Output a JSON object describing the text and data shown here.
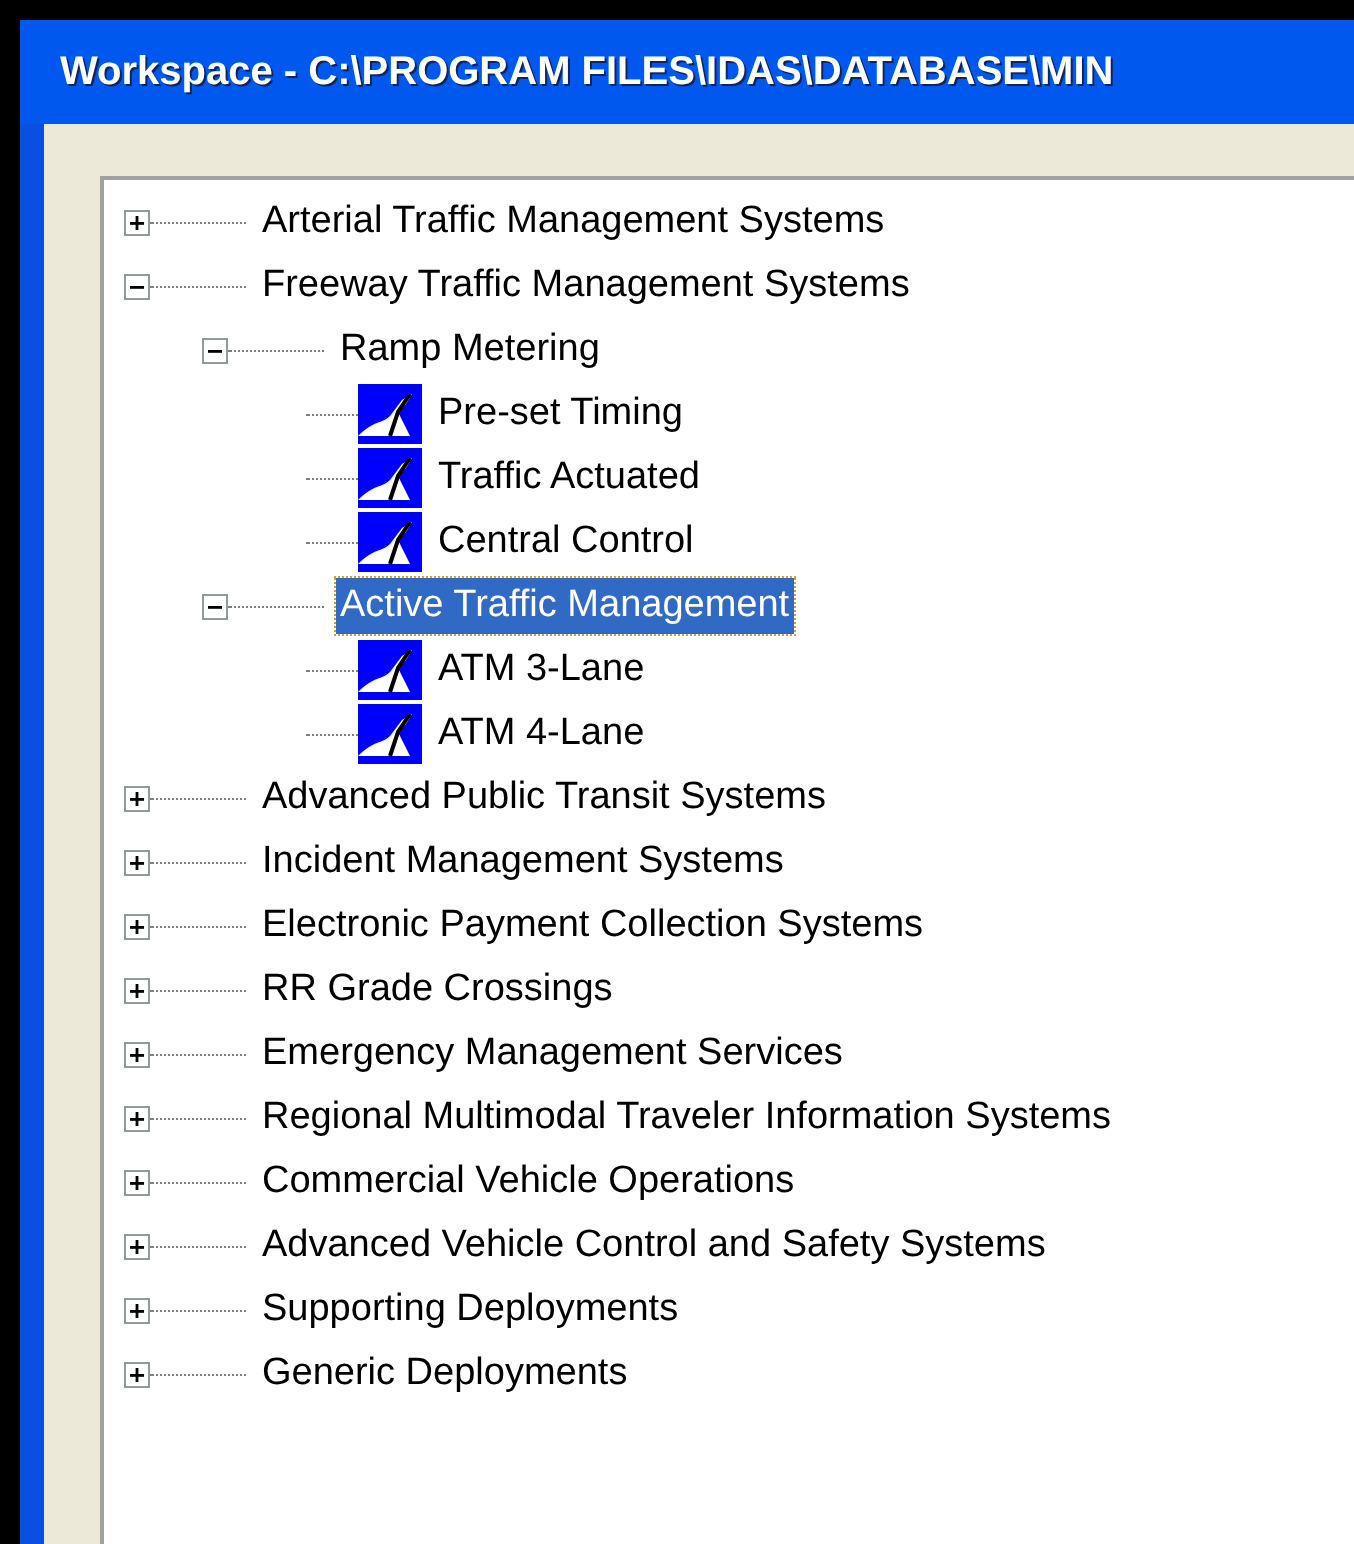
{
  "window": {
    "title": "Workspace - C:\\PROGRAM FILES\\IDAS\\DATABASE\\MIN"
  },
  "tree": {
    "items": [
      {
        "label": "Arterial Traffic Management Systems",
        "expanded": false,
        "selected": false
      },
      {
        "label": "Freeway Traffic Management Systems",
        "expanded": true,
        "selected": false,
        "children": [
          {
            "label": "Ramp Metering",
            "expanded": true,
            "selected": false,
            "children": [
              {
                "label": "Pre-set Timing",
                "kind": "leaf",
                "selected": false
              },
              {
                "label": "Traffic Actuated",
                "kind": "leaf",
                "selected": false
              },
              {
                "label": "Central Control",
                "kind": "leaf",
                "selected": false
              }
            ]
          },
          {
            "label": "Active Traffic Management",
            "expanded": true,
            "selected": true,
            "children": [
              {
                "label": "ATM 3-Lane",
                "kind": "leaf",
                "selected": false
              },
              {
                "label": "ATM 4-Lane",
                "kind": "leaf",
                "selected": false
              }
            ]
          }
        ]
      },
      {
        "label": "Advanced Public Transit Systems",
        "expanded": false,
        "selected": false
      },
      {
        "label": "Incident Management Systems",
        "expanded": false,
        "selected": false
      },
      {
        "label": "Electronic Payment Collection Systems",
        "expanded": false,
        "selected": false
      },
      {
        "label": "RR Grade Crossings",
        "expanded": false,
        "selected": false
      },
      {
        "label": "Emergency Management Services",
        "expanded": false,
        "selected": false
      },
      {
        "label": "Regional Multimodal Traveler Information Systems",
        "expanded": false,
        "selected": false
      },
      {
        "label": "Commercial Vehicle Operations",
        "expanded": false,
        "selected": false
      },
      {
        "label": "Advanced Vehicle Control and Safety Systems",
        "expanded": false,
        "selected": false
      },
      {
        "label": "Supporting Deployments",
        "expanded": false,
        "selected": false
      },
      {
        "label": "Generic Deployments",
        "expanded": false,
        "selected": false
      }
    ]
  }
}
